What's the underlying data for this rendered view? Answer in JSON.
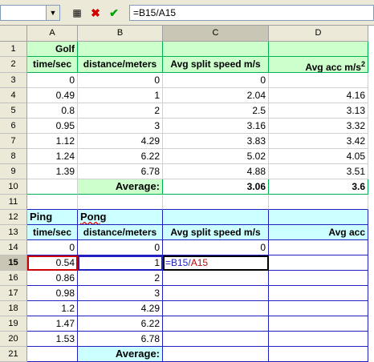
{
  "formula_bar": {
    "name_box": "",
    "formula": "=B15/A15",
    "icons": [
      "function-wizard-icon",
      "cancel-icon",
      "accept-icon"
    ]
  },
  "columns": [
    "A",
    "B",
    "C",
    "D"
  ],
  "rows": [
    "1",
    "2",
    "3",
    "4",
    "5",
    "6",
    "7",
    "8",
    "9",
    "10",
    "11",
    "12",
    "13",
    "14",
    "15",
    "16",
    "17",
    "18",
    "19",
    "20",
    "21"
  ],
  "golf": {
    "title": "Golf",
    "headers": [
      "time/sec",
      "distance/meters",
      "Avg split speed m/s",
      "Avg acc m/s"
    ],
    "acc_sup": "2",
    "data": [
      [
        "0",
        "0",
        "0",
        ""
      ],
      [
        "0.49",
        "1",
        "2.04",
        "4.16"
      ],
      [
        "0.8",
        "2",
        "2.5",
        "3.13"
      ],
      [
        "0.95",
        "3",
        "3.16",
        "3.32"
      ],
      [
        "1.12",
        "4.29",
        "3.83",
        "3.42"
      ],
      [
        "1.24",
        "6.22",
        "5.02",
        "4.05"
      ],
      [
        "1.39",
        "6.78",
        "4.88",
        "3.51"
      ]
    ],
    "average_label": "Average:",
    "average_speed": "3.06",
    "average_acc": "3.6"
  },
  "pingpong": {
    "title_a": "Ping",
    "title_b": "Pong",
    "headers": [
      "time/sec",
      "distance/meters",
      "Avg split speed m/s",
      "Avg acc"
    ],
    "data": [
      [
        "0",
        "0",
        "0",
        ""
      ],
      [
        "0.54",
        "1",
        "",
        ""
      ],
      [
        "0.86",
        "2",
        "",
        ""
      ],
      [
        "0.98",
        "3",
        "",
        ""
      ],
      [
        "1.2",
        "4.29",
        "",
        ""
      ],
      [
        "1.47",
        "6.22",
        "",
        ""
      ],
      [
        "1.53",
        "6.78",
        "",
        ""
      ]
    ],
    "editing_formula_prefix": "=B15/",
    "editing_formula_ref": "A15",
    "average_label": "Average:"
  },
  "colors": {
    "green_fill": "#ccffcc",
    "cyan_fill": "#ccffff",
    "green_border": "#00b050",
    "blue_border": "#2020c0",
    "ref_red": "#cc0000"
  }
}
